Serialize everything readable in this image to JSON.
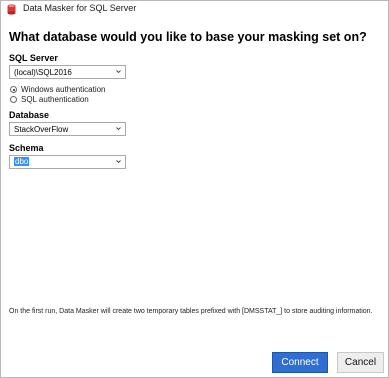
{
  "window": {
    "title": "Data Masker for SQL Server"
  },
  "heading": "What database would you like to base your masking set on?",
  "sql_server": {
    "label": "SQL Server",
    "value": "(local)\\SQL2016",
    "auth_options": [
      {
        "label": "Windows authentication",
        "selected": true
      },
      {
        "label": "SQL authentication",
        "selected": false
      }
    ]
  },
  "database": {
    "label": "Database",
    "value": "StackOverFlow"
  },
  "schema": {
    "label": "Schema",
    "value": "dbo"
  },
  "footer_note": "On the first run, Data Masker will create two temporary tables prefixed with [DMSSTAT_] to store auditing information.",
  "buttons": {
    "connect": "Connect",
    "cancel": "Cancel"
  },
  "colors": {
    "primary": "#2f6fd1",
    "selection": "#3390ff",
    "app_icon": "#d73a3a"
  },
  "icons": {
    "app": "database-icon",
    "dropdown": "chevron-down-icon"
  }
}
